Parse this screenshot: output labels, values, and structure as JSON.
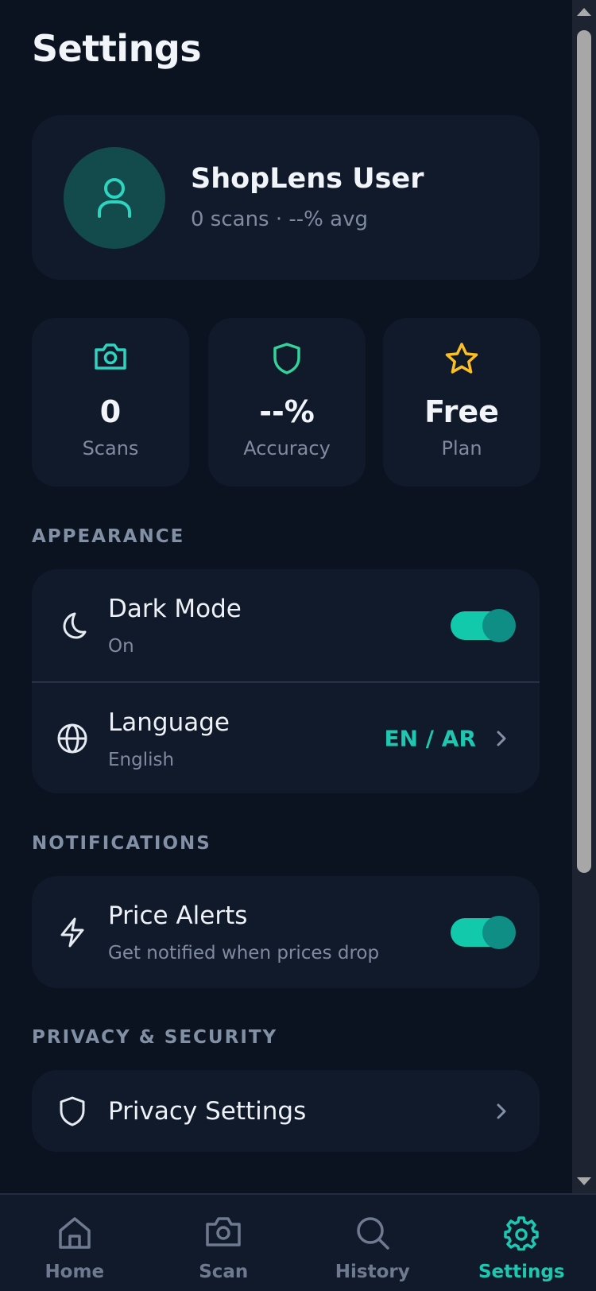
{
  "page": {
    "title": "Settings"
  },
  "profile": {
    "name": "ShopLens User",
    "subtitle": "0 scans · --% avg"
  },
  "stats": [
    {
      "value": "0",
      "label": "Scans",
      "icon": "camera-icon",
      "color": "#2dd4bf"
    },
    {
      "value": "--%",
      "label": "Accuracy",
      "icon": "shield-icon",
      "color": "#34d399"
    },
    {
      "value": "Free",
      "label": "Plan",
      "icon": "star-icon",
      "color": "#fbbf24"
    }
  ],
  "sections": {
    "appearance": "APPEARANCE",
    "notifications": "NOTIFICATIONS",
    "privacy": "PRIVACY & SECURITY"
  },
  "appearance": {
    "dark_mode": {
      "title": "Dark Mode",
      "subtitle": "On",
      "enabled": true
    },
    "language": {
      "title": "Language",
      "subtitle": "English",
      "value": "EN / AR"
    }
  },
  "notifications": {
    "price_alerts": {
      "title": "Price Alerts",
      "subtitle": "Get notified when prices drop",
      "enabled": true
    }
  },
  "privacy": {
    "privacy_settings": {
      "title": "Privacy Settings"
    }
  },
  "nav": [
    {
      "label": "Home",
      "icon": "home-icon",
      "active": false
    },
    {
      "label": "Scan",
      "icon": "camera-icon",
      "active": false
    },
    {
      "label": "History",
      "icon": "search-icon",
      "active": false
    },
    {
      "label": "Settings",
      "icon": "gear-icon",
      "active": true
    }
  ],
  "colors": {
    "accent": "#1ec7b0",
    "background": "#0b1220",
    "card": "#111a2b"
  }
}
